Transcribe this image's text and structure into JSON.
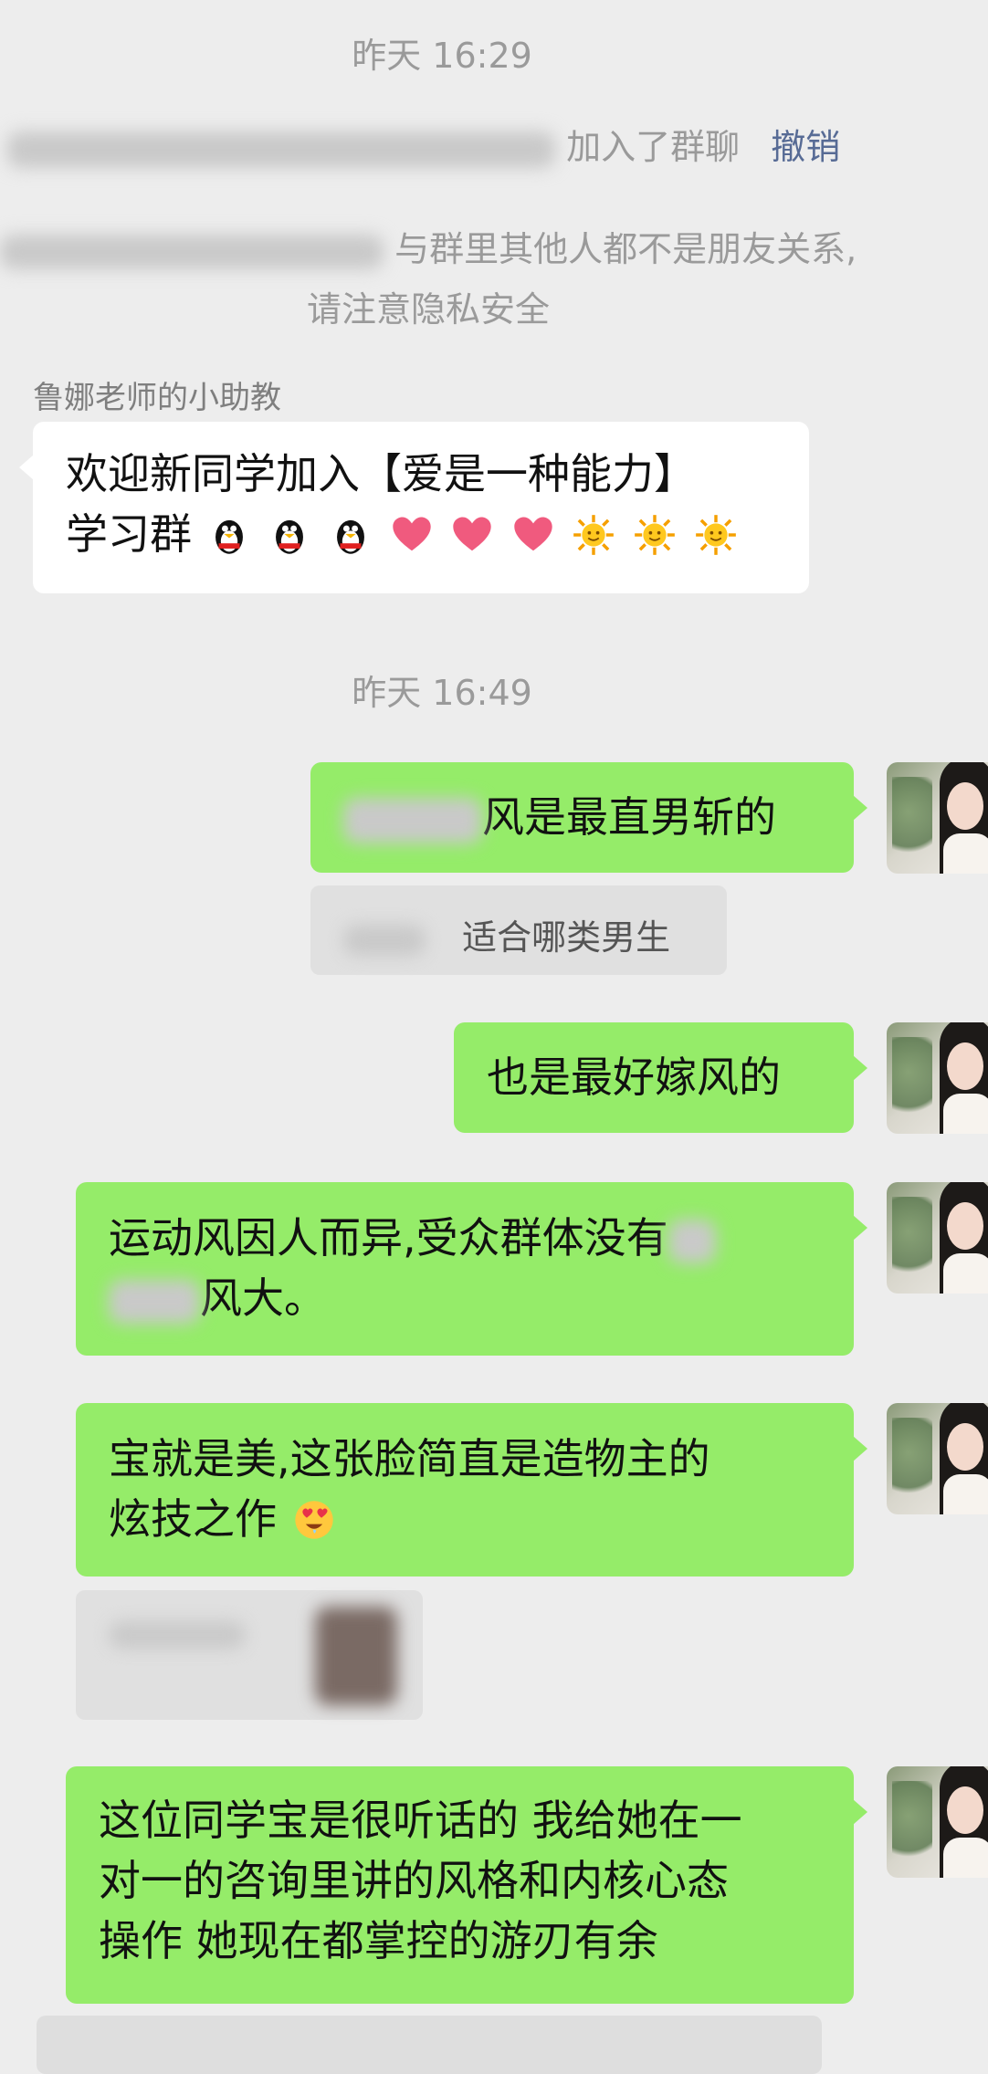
{
  "timestamps": [
    "昨天 16:29",
    "昨天 16:49"
  ],
  "system_join": {
    "suffix": "加入了群聊",
    "recall": "撤销"
  },
  "system_privacy": {
    "line1": "与群里其他人都不是朋友关系,",
    "line2": "请注意隐私安全"
  },
  "welcome": {
    "sender": "鲁娜老师的小助教",
    "line1": "欢迎新同学加入【爱是一种能力】",
    "line2_text": "学习群",
    "emojis": [
      "penguin-emoji",
      "penguin-emoji",
      "penguin-emoji",
      "heart-emoji",
      "heart-emoji",
      "heart-emoji",
      "sun-emoji",
      "sun-emoji",
      "sun-emoji"
    ]
  },
  "messages": {
    "m1": {
      "text": "风是最直男斩的",
      "quote": "适合哪类男生"
    },
    "m2": {
      "text": "也是最好嫁风的"
    },
    "m3": {
      "line1": "运动风因人而异,受众群体没有",
      "line2": "风大。"
    },
    "m4": {
      "line1": "宝就是美,这张脸简直是造物主的",
      "line2": "炫技之作"
    },
    "m5": {
      "line1": "这位同学宝是很听话的 我给她在一",
      "line2": "对一的咨询里讲的风格和内核心态",
      "line3": "操作 她现在都掌控的游刃有余"
    }
  },
  "colors": {
    "background": "#ededed",
    "bubble_green": "#95ec69",
    "bubble_white": "#ffffff",
    "link": "#576b95"
  }
}
